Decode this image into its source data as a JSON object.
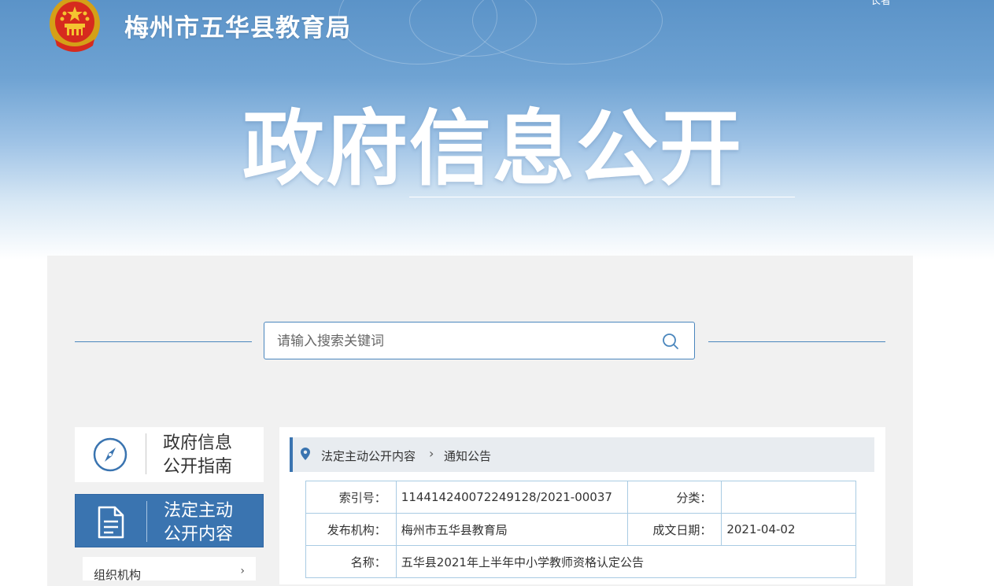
{
  "header": {
    "site_name": "梅州市五华县教育局",
    "banner_title": "政府信息公开",
    "top_link": "长者"
  },
  "search": {
    "placeholder": "请输入搜索关键词"
  },
  "sidebar": {
    "items": [
      {
        "label_line1": "政府信息",
        "label_line2": "公开指南",
        "icon": "compass-icon"
      },
      {
        "label_line1": "法定主动",
        "label_line2": "公开内容",
        "icon": "document-icon"
      }
    ],
    "sub_item": {
      "label": "组织机构",
      "icon": "chevron-right-icon"
    }
  },
  "breadcrumb": {
    "items": [
      "法定主动公开内容",
      "通知公告"
    ]
  },
  "info_table": {
    "index_label": "索引号：",
    "index_value": "114414240072249128/2021-00037",
    "category_label": "分类：",
    "category_value": "",
    "publisher_label": "发布机构：",
    "publisher_value": "梅州市五华县教育局",
    "date_label": "成文日期：",
    "date_value": "2021-04-02",
    "name_label": "名称：",
    "name_value": "五华县2021年上半年中小学教师资格认定公告"
  },
  "colors": {
    "accent": "#3a74b0",
    "border": "#a9cbe3",
    "panel_bg": "#f1f1f1"
  }
}
